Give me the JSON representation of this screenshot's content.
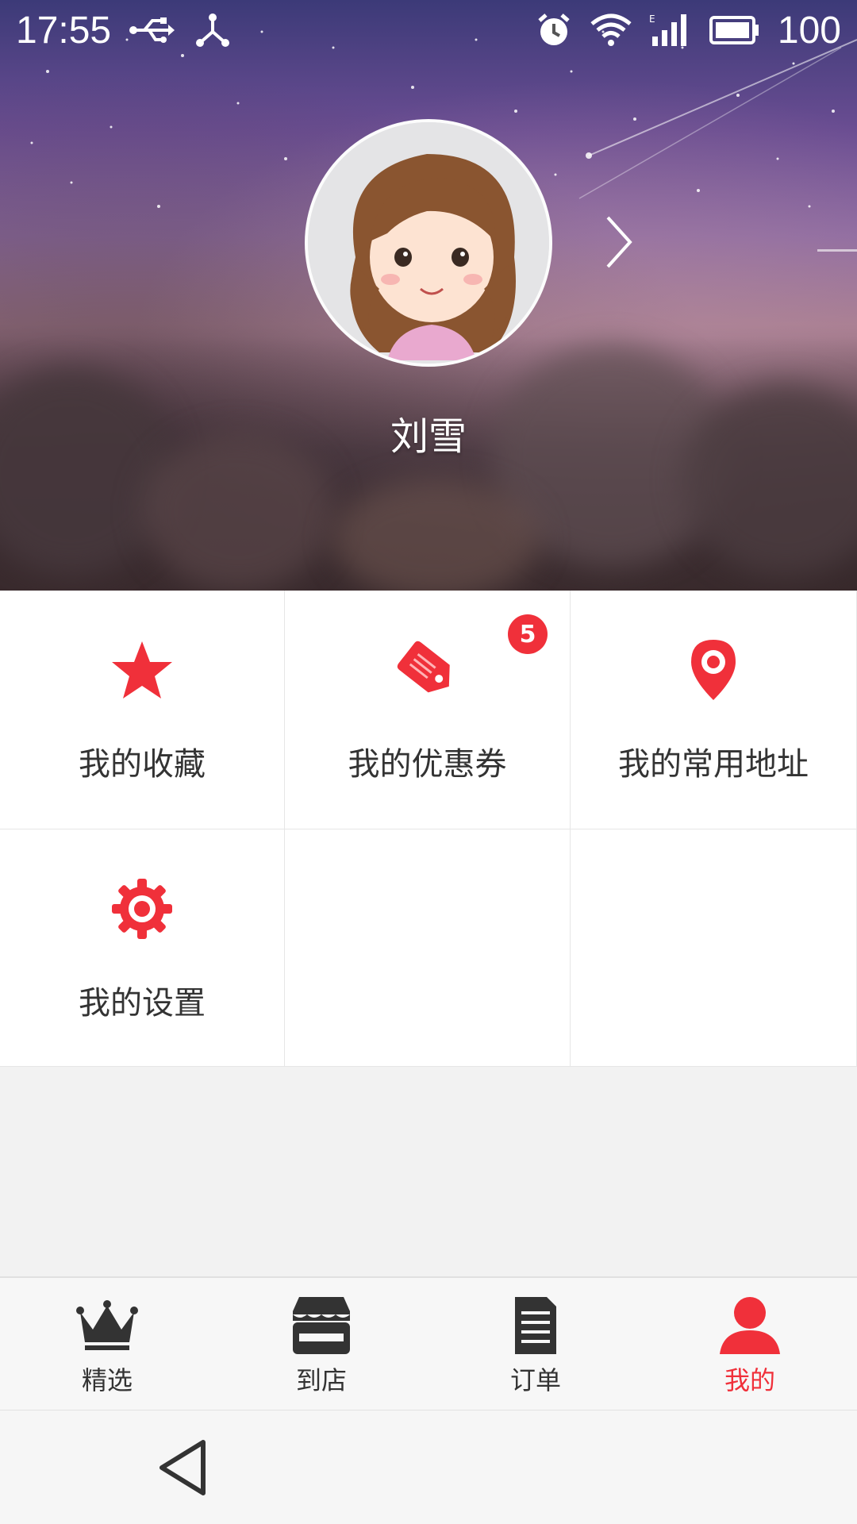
{
  "status_bar": {
    "time": "17:55",
    "battery": "100",
    "icons": [
      "usb-icon",
      "share-icon",
      "alarm-icon",
      "wifi-icon",
      "signal-icon",
      "battery-icon"
    ]
  },
  "profile": {
    "username": "刘雪",
    "avatar": "avatar-icon"
  },
  "menu": {
    "items": [
      {
        "label": "我的收藏",
        "icon": "star-icon"
      },
      {
        "label": "我的优惠券",
        "icon": "coupon-tag-icon",
        "badge": "5"
      },
      {
        "label": "我的常用地址",
        "icon": "location-pin-icon"
      },
      {
        "label": "我的设置",
        "icon": "gear-icon"
      }
    ]
  },
  "tabbar": {
    "tabs": [
      {
        "label": "精选",
        "icon": "crown-icon",
        "active": false
      },
      {
        "label": "到店",
        "icon": "store-icon",
        "active": false
      },
      {
        "label": "订单",
        "icon": "document-icon",
        "active": false
      },
      {
        "label": "我的",
        "icon": "person-icon",
        "active": true
      }
    ]
  },
  "colors": {
    "accent": "#f0303a",
    "text": "#333333",
    "tab_inactive": "#333333"
  }
}
